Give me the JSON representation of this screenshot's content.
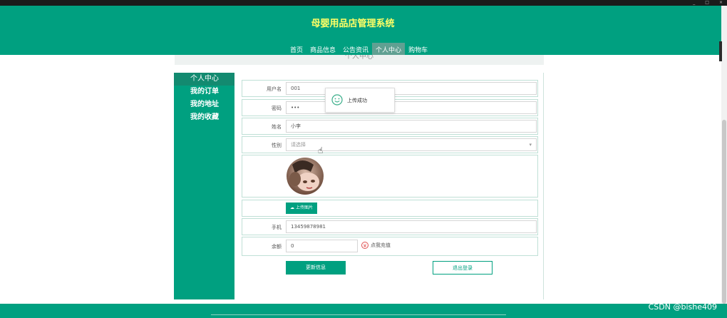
{
  "window": {
    "controls": [
      "_",
      "□",
      "×"
    ]
  },
  "site": {
    "title": "母婴用品店管理系统"
  },
  "nav": {
    "items": [
      {
        "label": "首页",
        "active": false
      },
      {
        "label": "商品信息",
        "active": false
      },
      {
        "label": "公告资讯",
        "active": false
      },
      {
        "label": "个人中心",
        "active": true
      },
      {
        "label": "购物车",
        "active": false
      }
    ]
  },
  "page": {
    "faded_title": "个人中心"
  },
  "sidebar": {
    "items": [
      {
        "label": "个人中心",
        "active": true
      },
      {
        "label": "我的订单",
        "active": false
      },
      {
        "label": "我的地址",
        "active": false
      },
      {
        "label": "我的收藏",
        "active": false
      }
    ]
  },
  "form": {
    "username": {
      "label": "用户名",
      "value": "001"
    },
    "password": {
      "label": "密码",
      "value": "•••"
    },
    "name": {
      "label": "姓名",
      "value": "小李"
    },
    "gender": {
      "label": "性别",
      "placeholder": "请选择"
    },
    "upload": {
      "label": "上传图片",
      "icon": "cloud-upload-icon"
    },
    "phone": {
      "label": "手机",
      "value": "13459878981"
    },
    "balance": {
      "label": "余额",
      "value": "0",
      "recharge_label": "点我充值"
    }
  },
  "toast": {
    "message": "上传成功",
    "icon": "smile-icon"
  },
  "actions": {
    "update_label": "更新信息",
    "logout_label": "退出登录"
  },
  "watermark": {
    "text": "CSDN @bishe409"
  },
  "colors": {
    "primary": "#00a080",
    "title": "#ffff66"
  }
}
